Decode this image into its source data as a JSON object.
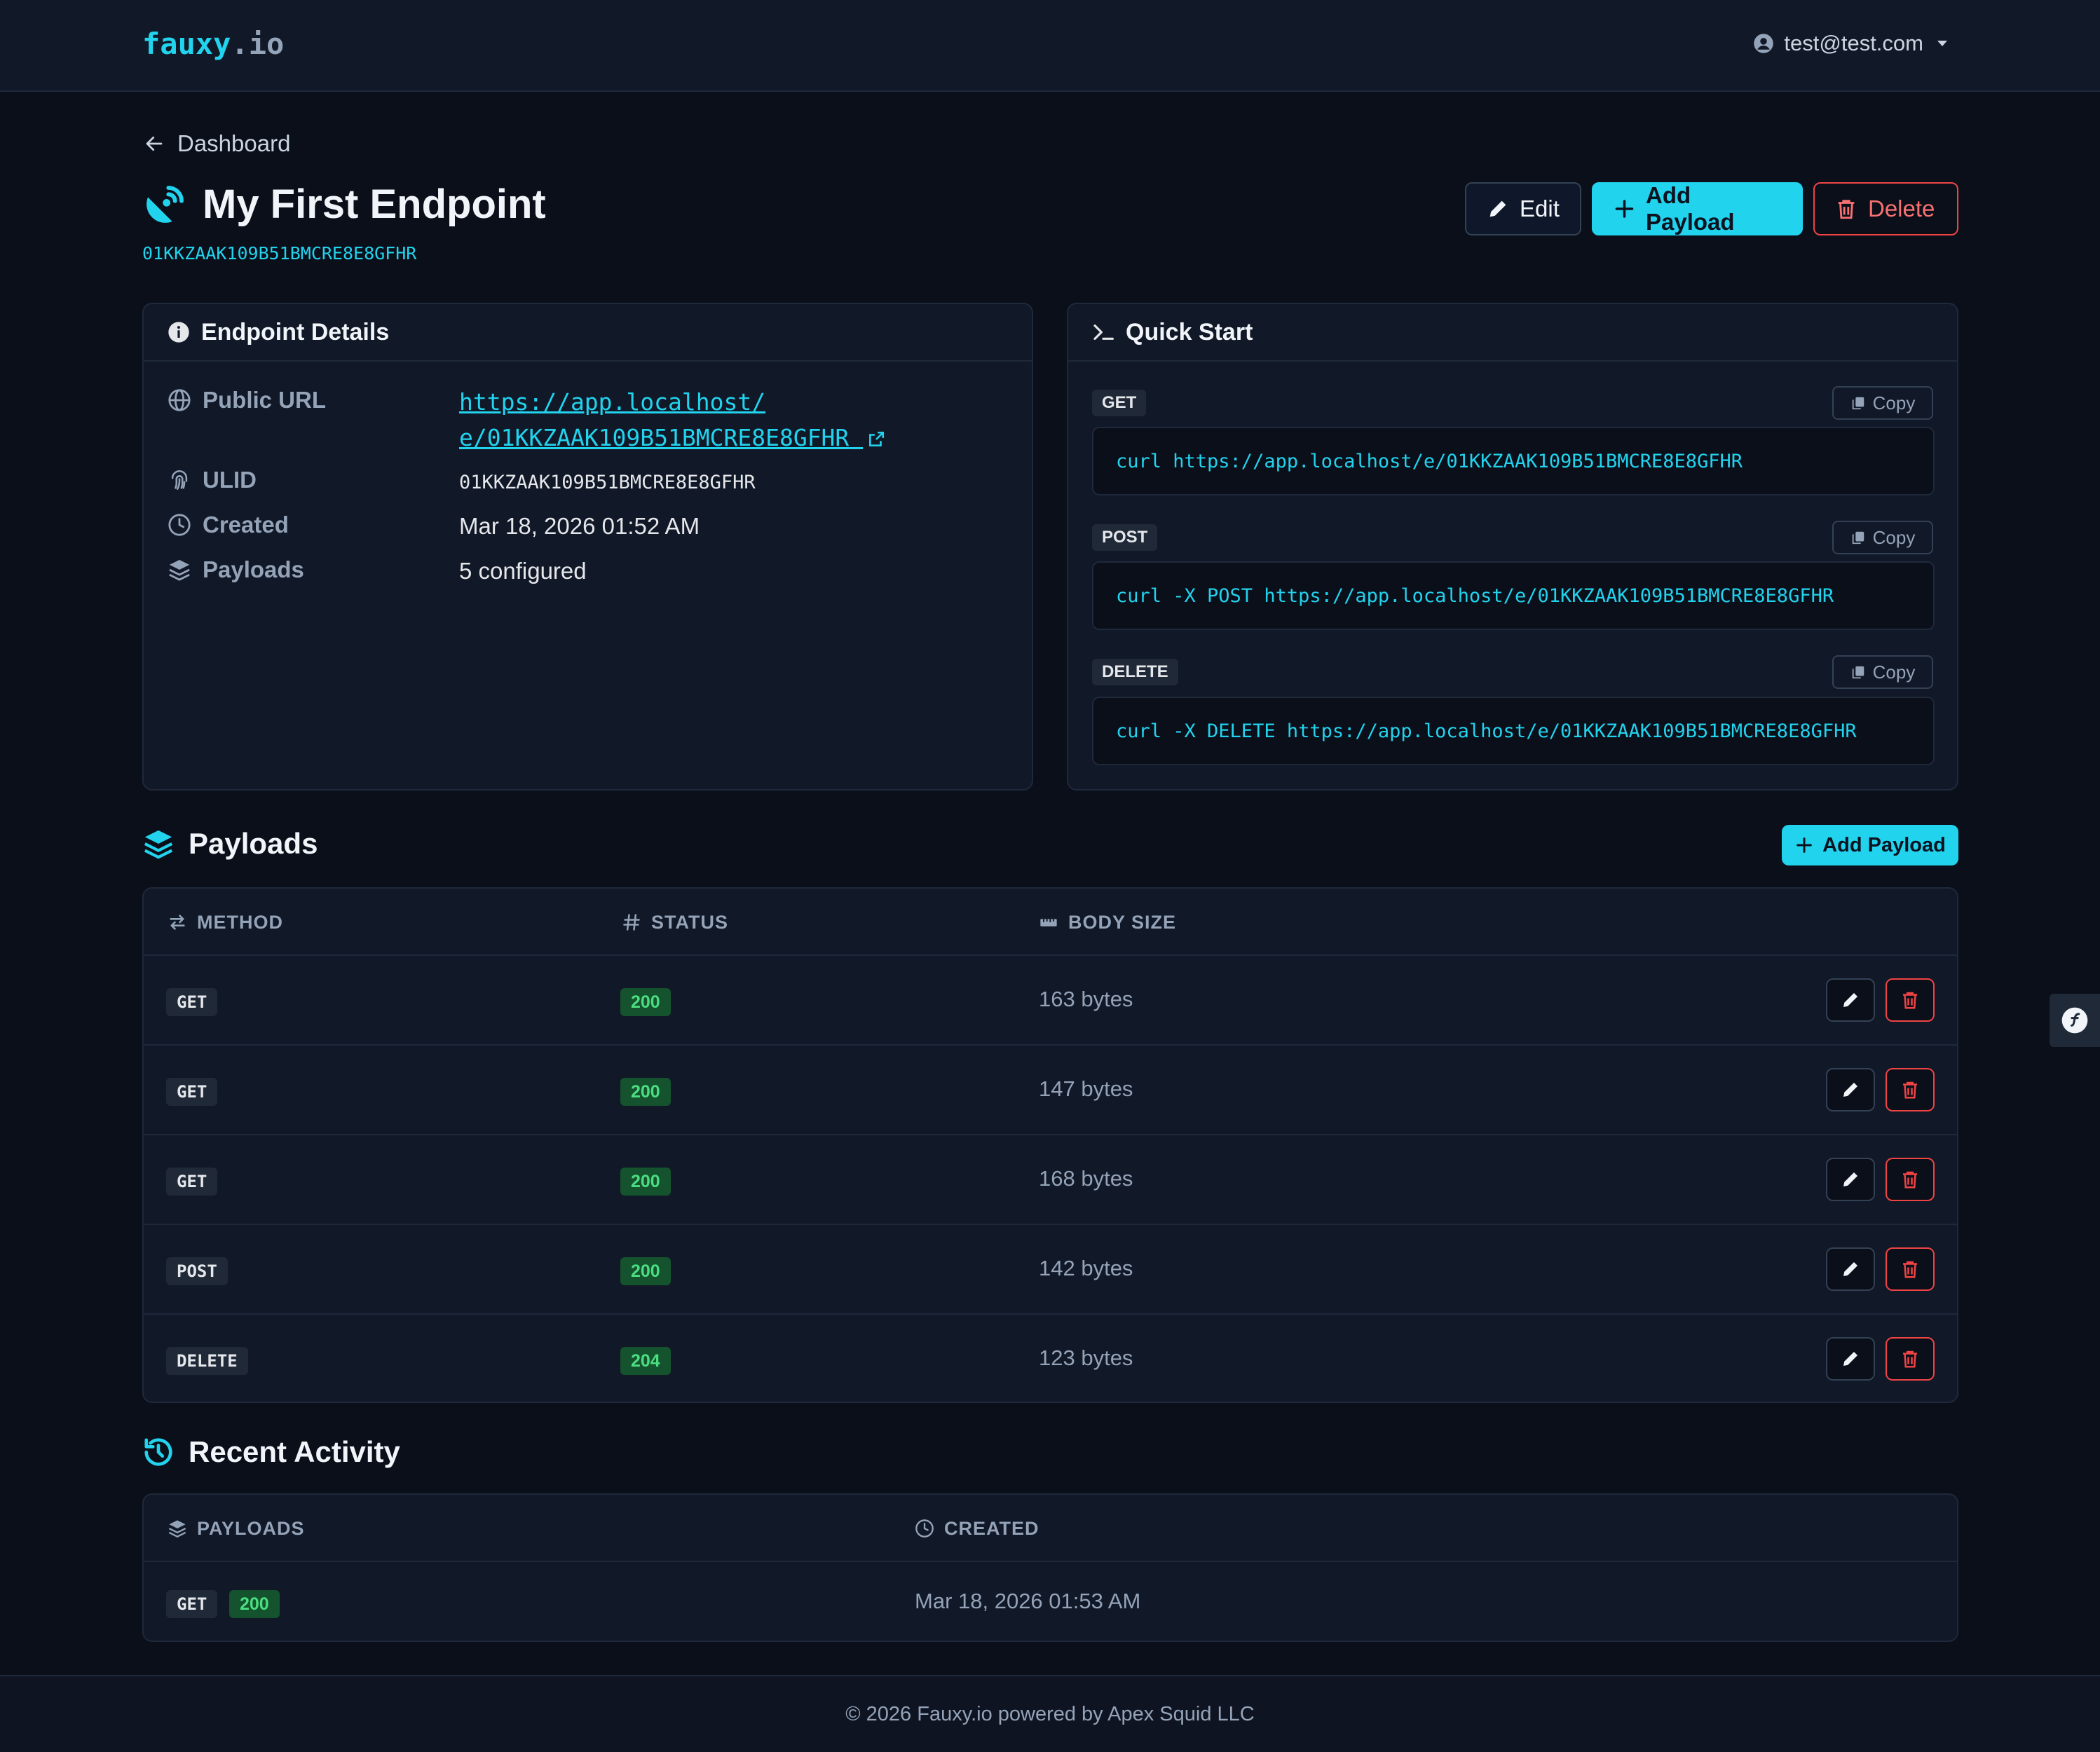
{
  "nav": {
    "brand_main": "fauxy",
    "brand_suffix": ".io",
    "user_email": "test@test.com"
  },
  "breadcrumb": {
    "label": "Dashboard"
  },
  "header": {
    "title": "My First Endpoint",
    "ulid": "01KKZAAK109B51BMCRE8E8GFHR",
    "edit_label": "Edit",
    "add_payload_label": "Add Payload",
    "delete_label": "Delete"
  },
  "details": {
    "title": "Endpoint Details",
    "public_url_label": "Public URL",
    "public_url_line1": "https://app.localhost/",
    "public_url_line2": "e/01KKZAAK109B51BMCRE8E8GFHR",
    "ulid_label": "ULID",
    "ulid_value": "01KKZAAK109B51BMCRE8E8GFHR",
    "created_label": "Created",
    "created_value": "Mar 18, 2026 01:52 AM",
    "payloads_label": "Payloads",
    "payloads_value": "5 configured"
  },
  "quick_start": {
    "title": "Quick Start",
    "copy_label": "Copy",
    "items": [
      {
        "method": "GET",
        "command": "curl https://app.localhost/e/01KKZAAK109B51BMCRE8E8GFHR"
      },
      {
        "method": "POST",
        "command": "curl -X POST https://app.localhost/e/01KKZAAK109B51BMCRE8E8GFHR"
      },
      {
        "method": "DELETE",
        "command": "curl -X DELETE https://app.localhost/e/01KKZAAK109B51BMCRE8E8GFHR"
      }
    ]
  },
  "payloads": {
    "title": "Payloads",
    "add_label": "Add Payload",
    "columns": {
      "method": "METHOD",
      "status": "STATUS",
      "body_size": "BODY SIZE"
    },
    "rows": [
      {
        "method": "GET",
        "status": "200",
        "body_size": "163 bytes"
      },
      {
        "method": "GET",
        "status": "200",
        "body_size": "147 bytes"
      },
      {
        "method": "GET",
        "status": "200",
        "body_size": "168 bytes"
      },
      {
        "method": "POST",
        "status": "200",
        "body_size": "142 bytes"
      },
      {
        "method": "DELETE",
        "status": "204",
        "body_size": "123 bytes"
      }
    ]
  },
  "activity": {
    "title": "Recent Activity",
    "columns": {
      "payloads": "PAYLOADS",
      "created": "CREATED"
    },
    "rows": [
      {
        "method": "GET",
        "status": "200",
        "created": "Mar 18, 2026 01:53 AM"
      }
    ]
  },
  "footer": {
    "text": "© 2026 Fauxy.io powered by Apex Squid LLC"
  },
  "colors": {
    "accent": "#22d3ee",
    "danger": "#ef4444",
    "success": "#4ade80",
    "background": "#0b0f1a",
    "card": "#111827"
  }
}
